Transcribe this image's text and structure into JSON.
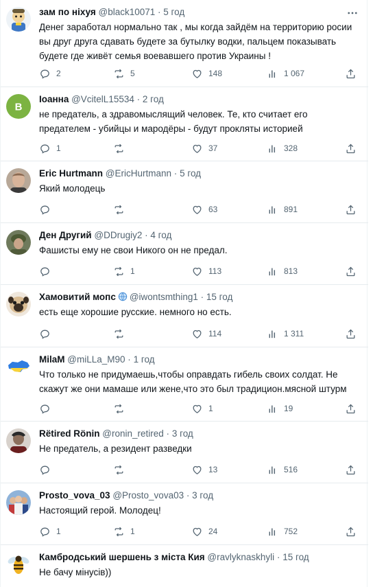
{
  "colors": {
    "icon": "#536471",
    "text": "#0f1419",
    "divider": "#e6ebee"
  },
  "icons": {
    "reply": "reply-icon",
    "retweet": "retweet-icon",
    "like": "heart-icon",
    "views": "views-icon",
    "share": "share-icon",
    "more": "more-icon"
  },
  "tweets": [
    {
      "name": "зам по ніхуя",
      "handle": "@black10071",
      "dot": "·",
      "time": "5 год",
      "text": "Денег  заработал нормально так , мы когда зайдём на территорию росии вы друг друга сдавать будете за бутылку водки, пальцем показывать будете где живёт семья воевавшего против Украины !",
      "replies": "2",
      "retweets": "5",
      "likes": "148",
      "views": "1 067",
      "avatar": "cartoon"
    },
    {
      "name": "Іоанна",
      "handle": "@VcitelL15534",
      "dot": "·",
      "time": "2 год",
      "text": "не предатель, а здравомыслящий человек. Те, кто считает его предателем - убийцы и мародёры - будут прокляты историей",
      "replies": "1",
      "retweets": "",
      "likes": "37",
      "views": "328",
      "avatar": "letter",
      "avatar_letter": "B"
    },
    {
      "name": "Eric Hurtmann",
      "handle": "@EricHurtmann",
      "dot": "·",
      "time": "5 год",
      "text": "Який молодець",
      "replies": "",
      "retweets": "",
      "likes": "63",
      "views": "891",
      "avatar": "photo"
    },
    {
      "name": "Ден Другий",
      "handle": "@DDrugiy2",
      "dot": "·",
      "time": "4 год",
      "text": "Фашисты ему не свои Никого он не предал.",
      "replies": "",
      "retweets": "1",
      "likes": "113",
      "views": "813",
      "avatar": "soldier"
    },
    {
      "name": "Хамовитий мопс",
      "handle": "@iwontsmthing1",
      "dot": "·",
      "time": "15 год",
      "text": "есть еще хорошие русские. немного но есть.",
      "replies": "",
      "retweets": "",
      "likes": "114",
      "views": "1 311",
      "avatar": "pug",
      "globe": true
    },
    {
      "name": "MilaM",
      "handle": "@miLLa_M90",
      "dot": "·",
      "time": "1 год",
      "text": "Что только не придумаешь,чтобы оправдать гибель своих солдат. Не скажут   же они мамаше или жене,что это был традицион.мясной штурм",
      "replies": "",
      "retweets": "",
      "likes": "1",
      "views": "19",
      "avatar": "map"
    },
    {
      "name": "Rëtired Rönin",
      "handle": "@ronin_retired",
      "dot": "·",
      "time": "3 год",
      "text": "Не предатель, а резидент разведки",
      "replies": "",
      "retweets": "",
      "likes": "13",
      "views": "516",
      "avatar": "ronin"
    },
    {
      "name": "Prosto_vova_03",
      "handle": "@Prosto_vova03",
      "dot": "·",
      "time": "3 год",
      "text": "Настоящий герой. Молодец!",
      "replies": "1",
      "retweets": "1",
      "likes": "24",
      "views": "752",
      "avatar": "group"
    },
    {
      "name": "Камбродський шершень з міста Кия",
      "handle": "@ravlyknaskhyli",
      "dot": "·",
      "time": "15 год",
      "text": "Не бачу мінусів))",
      "replies": "",
      "retweets": "",
      "likes": "",
      "views": "",
      "avatar": "hornet"
    }
  ]
}
